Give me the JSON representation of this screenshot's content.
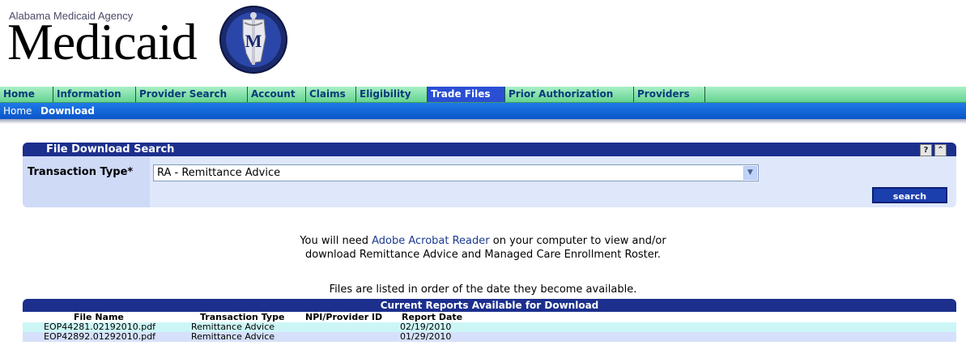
{
  "header": {
    "agency": "Alabama Medicaid Agency",
    "brand": "Medicaid",
    "seal_letter": "M"
  },
  "nav": {
    "items": [
      {
        "label": "Home"
      },
      {
        "label": "Information"
      },
      {
        "label": "Provider Search"
      },
      {
        "label": "Account"
      },
      {
        "label": "Claims"
      },
      {
        "label": "Eligibility"
      },
      {
        "label": "Trade Files",
        "active": true
      },
      {
        "label": "Prior Authorization"
      },
      {
        "label": "Providers"
      }
    ]
  },
  "subnav": {
    "home": "Home",
    "download": "Download"
  },
  "search_panel": {
    "title": "File Download Search",
    "help_icon": "?",
    "collapse_icon": "⌃",
    "field_label": "Transaction Type*",
    "selected_value": "RA - Remittance Advice",
    "search_button": "search"
  },
  "info": {
    "line1_pre": "You will need ",
    "line1_link": "Adobe Acrobat Reader",
    "line1_post": " on your computer to view and/or",
    "line2": "download Remittance Advice and Managed Care Enrollment Roster.",
    "line3": "Files are listed in order of the date they become available."
  },
  "results": {
    "title": "Current Reports Available for Download",
    "columns": [
      "File Name",
      "Transaction Type",
      "NPI/Provider ID",
      "Report Date"
    ],
    "rows": [
      {
        "file": "EOP44281.02192010.pdf",
        "type": "Remittance Advice",
        "npi": "",
        "date": "02/19/2010"
      },
      {
        "file": "EOP42892.01292010.pdf",
        "type": "Remittance Advice",
        "npi": "",
        "date": "01/29/2010"
      }
    ]
  }
}
